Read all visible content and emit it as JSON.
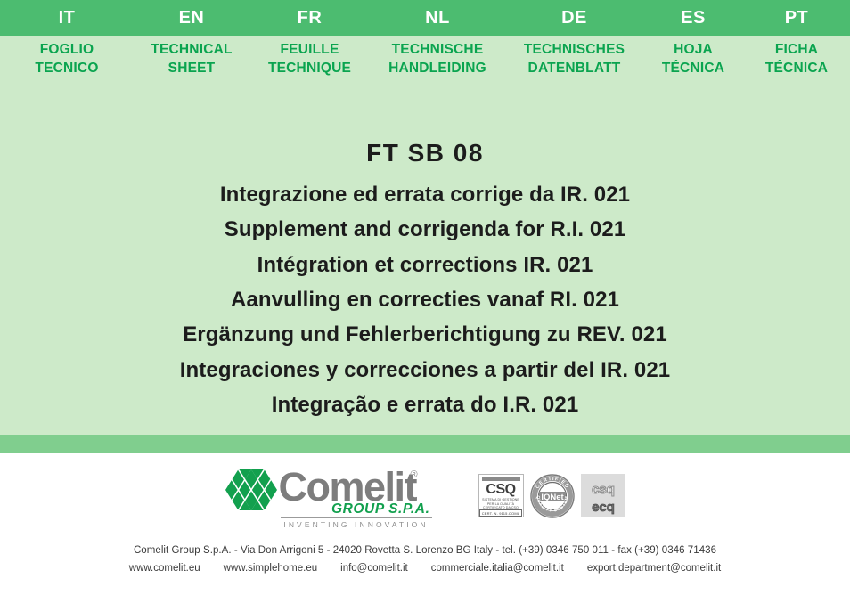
{
  "header": {
    "languages": [
      {
        "code": "IT",
        "name_line1": "FOGLIO",
        "name_line2": "TECNICO"
      },
      {
        "code": "EN",
        "name_line1": "TECHNICAL",
        "name_line2": "SHEET"
      },
      {
        "code": "FR",
        "name_line1": "FEUILLE",
        "name_line2": "TECHNIQUE"
      },
      {
        "code": "NL",
        "name_line1": "TECHNISCHE",
        "name_line2": "HANDLEIDING"
      },
      {
        "code": "DE",
        "name_line1": "TECHNISCHES",
        "name_line2": "DATENBLATT"
      },
      {
        "code": "ES",
        "name_line1": "HOJA",
        "name_line2": "TÉCNICA"
      },
      {
        "code": "PT",
        "name_line1": "FICHA",
        "name_line2": "TÉCNICA"
      }
    ]
  },
  "title": {
    "doc_code": "FT SB 08",
    "subtitles": [
      "Integrazione ed errata corrige da IR. 021",
      "Supplement and corrigenda for R.I. 021",
      "Intégration et corrections IR. 021",
      "Aanvulling en correcties vanaf RI. 021",
      "Ergänzung und Fehlerberichtigung zu REV. 021",
      "Integraciones y correcciones a partir del IR. 021",
      "Integração e errata do I.R. 021"
    ]
  },
  "logo": {
    "wordmark": "Comelit",
    "registered": "®",
    "group": "GROUP S.P.A.",
    "tagline": "INVENTING INNOVATION"
  },
  "certifications": [
    {
      "id": "csq",
      "label": "CSQ",
      "fine_print_line1": "SISTEMA DI GESTIONE PER LA QUALITÀ",
      "fine_print_line2": "CERTIFICATO DA CSQ",
      "code": "CERT. N. 9115.COML"
    },
    {
      "id": "iqnet",
      "label": "IQNet",
      "ring_top": "CERTIFIED",
      "ring_bottom": "QUALITY SYSTEM"
    },
    {
      "id": "csq-ecq",
      "label_top": "csq",
      "label_bottom": "ecq"
    }
  ],
  "footer": {
    "company_line": "Comelit Group S.p.A. - Via Don Arrigoni 5 - 24020 Rovetta S. Lorenzo BG Italy - tel. (+39) 0346 750 011 - fax (+39) 0346 71436",
    "links": [
      "www.comelit.eu",
      "www.simplehome.eu",
      "info@comelit.it",
      "commerciale.italia@comelit.it",
      "export.department@comelit.it"
    ]
  },
  "colors": {
    "header_green": "#4cbc70",
    "background_green": "#cdeac9",
    "strip_green": "#80ce8e",
    "label_green": "#0aa44f",
    "logo_green": "#12a04e",
    "logo_gray": "#7d7d7d",
    "text_dark": "#1c1c1c"
  }
}
